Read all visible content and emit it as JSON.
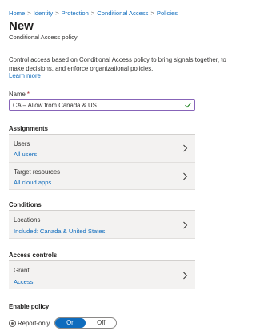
{
  "breadcrumb": [
    {
      "label": "Home"
    },
    {
      "label": "Identity"
    },
    {
      "label": "Protection"
    },
    {
      "label": "Conditional Access"
    },
    {
      "label": "Policies"
    }
  ],
  "breadcrumb_separator": ">",
  "page": {
    "title": "New",
    "subtitle": "Conditional Access policy",
    "description": "Control access based on Conditional Access policy to bring signals together, to make decisions, and enforce organizational policies.",
    "learn_more": "Learn more"
  },
  "name_field": {
    "label": "Name",
    "required_mark": "*",
    "value": "CA – Allow from Canada & US",
    "valid_icon": "checkmark-icon"
  },
  "assignments": {
    "title": "Assignments",
    "users": {
      "label": "Users",
      "value": "All users"
    },
    "targets": {
      "label": "Target resources",
      "value": "All cloud apps"
    }
  },
  "conditions": {
    "title": "Conditions",
    "locations": {
      "label": "Locations",
      "value": "Included: Canada & United States"
    }
  },
  "access_controls": {
    "title": "Access controls",
    "grant": {
      "label": "Grant",
      "value": "Access"
    }
  },
  "enable_policy": {
    "title": "Enable policy",
    "options": [
      "Report-only",
      "On",
      "Off"
    ],
    "selected": "On"
  },
  "colors": {
    "link": "#0f6cbd",
    "accent": "#0f6cbd",
    "input_border": "#8764b8",
    "valid": "#107c10"
  }
}
